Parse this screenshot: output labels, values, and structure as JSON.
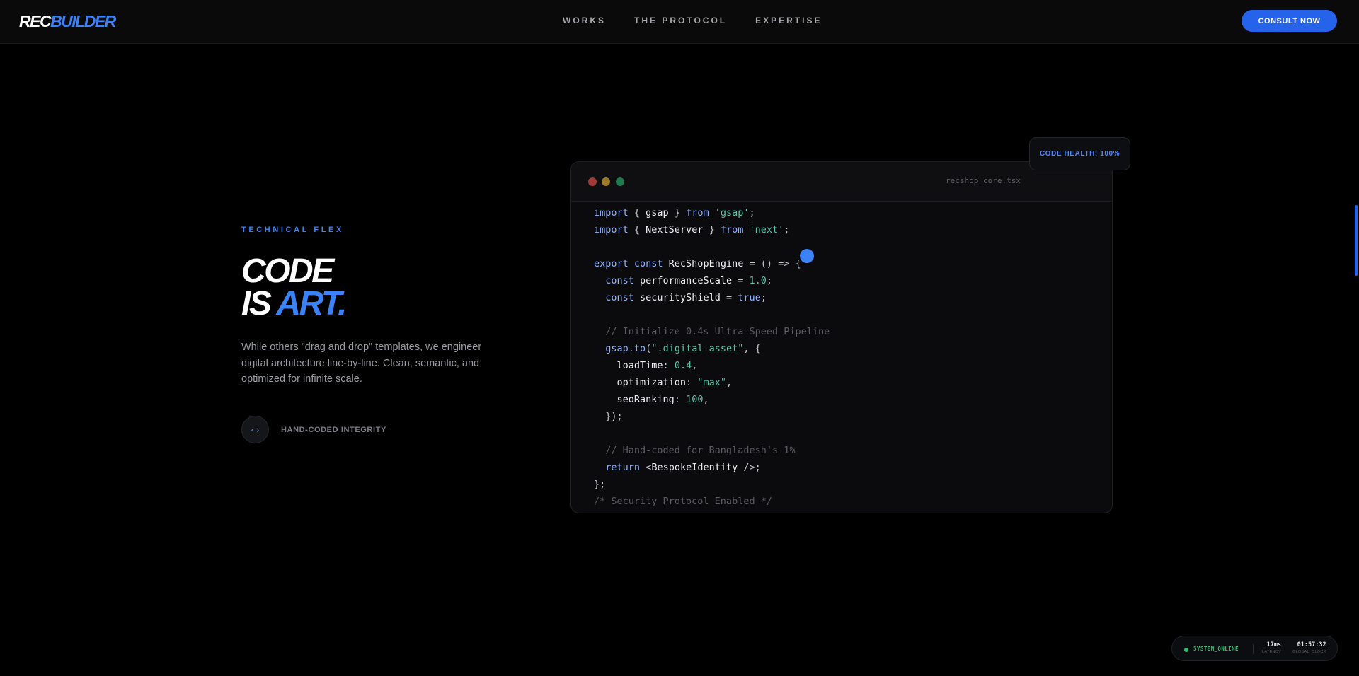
{
  "brand": {
    "part1": "REC",
    "part2": "BUILDER"
  },
  "nav": {
    "links": [
      "WORKS",
      "THE PROTOCOL",
      "EXPERTISE"
    ],
    "cta": "CONSULT NOW"
  },
  "hero": {
    "eyebrow": "TECHNICAL FLEX",
    "headline_line1": "CODE",
    "headline_line2_a": "IS ",
    "headline_line2_b": "ART.",
    "description": "While others \"drag and drop\" templates, we engineer digital architecture line-by-line. Clean, semantic, and optimized for infinite scale.",
    "badge_icon": "code-brackets-icon",
    "badge_glyph": "‹›",
    "badge_label": "HAND-CODED INTEGRITY"
  },
  "editor": {
    "filename": "recshop_core.tsx",
    "health": "CODE HEALTH: 100%",
    "lines": [
      [
        [
          "kw",
          "import "
        ],
        [
          "p",
          "{ "
        ],
        [
          "id",
          "gsap"
        ],
        [
          "p",
          " } "
        ],
        [
          "kw",
          "from "
        ],
        [
          "str",
          "'gsap'"
        ],
        [
          "p",
          ";"
        ]
      ],
      [
        [
          "kw",
          "import "
        ],
        [
          "p",
          "{ "
        ],
        [
          "id",
          "NextServer"
        ],
        [
          "p",
          " } "
        ],
        [
          "kw",
          "from "
        ],
        [
          "str",
          "'next'"
        ],
        [
          "p",
          ";"
        ]
      ],
      [],
      [
        [
          "kw",
          "export const "
        ],
        [
          "id",
          "RecShopEngine"
        ],
        [
          "p",
          " = () => {"
        ]
      ],
      [
        [
          "p",
          "  "
        ],
        [
          "kw",
          "const "
        ],
        [
          "id",
          "performanceScale"
        ],
        [
          "p",
          " = "
        ],
        [
          "num",
          "1.0"
        ],
        [
          "p",
          ";"
        ]
      ],
      [
        [
          "p",
          "  "
        ],
        [
          "kw",
          "const "
        ],
        [
          "id",
          "securityShield"
        ],
        [
          "p",
          " = "
        ],
        [
          "kw",
          "true"
        ],
        [
          "p",
          ";"
        ]
      ],
      [],
      [
        [
          "cm",
          "  // Initialize 0.4s Ultra-Speed Pipeline"
        ]
      ],
      [
        [
          "p",
          "  "
        ],
        [
          "fn",
          "gsap.to"
        ],
        [
          "p",
          "("
        ],
        [
          "str",
          "\".digital-asset\""
        ],
        [
          "p",
          ", {"
        ]
      ],
      [
        [
          "p",
          "    "
        ],
        [
          "id",
          "loadTime"
        ],
        [
          "p",
          ": "
        ],
        [
          "num",
          "0.4"
        ],
        [
          "p",
          ","
        ]
      ],
      [
        [
          "p",
          "    "
        ],
        [
          "id",
          "optimization"
        ],
        [
          "p",
          ": "
        ],
        [
          "str",
          "\"max\""
        ],
        [
          "p",
          ","
        ]
      ],
      [
        [
          "p",
          "    "
        ],
        [
          "id",
          "seoRanking"
        ],
        [
          "p",
          ": "
        ],
        [
          "num",
          "100"
        ],
        [
          "p",
          ","
        ]
      ],
      [
        [
          "p",
          "  });"
        ]
      ],
      [],
      [
        [
          "cm",
          "  // Hand-coded for Bangladesh's 1%"
        ]
      ],
      [
        [
          "p",
          "  "
        ],
        [
          "kw",
          "return "
        ],
        [
          "p",
          "<"
        ],
        [
          "id",
          "BespokeIdentity"
        ],
        [
          "p",
          " />;"
        ]
      ],
      [
        [
          "p",
          "};"
        ]
      ],
      [
        [
          "cm",
          "/* Security Protocol Enabled */"
        ]
      ]
    ]
  },
  "status": {
    "state": "SYSTEM_ONLINE",
    "latency_value": "17ms",
    "latency_label": "LATENCY",
    "clock_value": "01:57:32",
    "clock_label": "GLOBAL_CLOCK"
  },
  "colors": {
    "accent": "#3b82f6",
    "cta": "#2563eb",
    "online": "#2fbf71"
  }
}
